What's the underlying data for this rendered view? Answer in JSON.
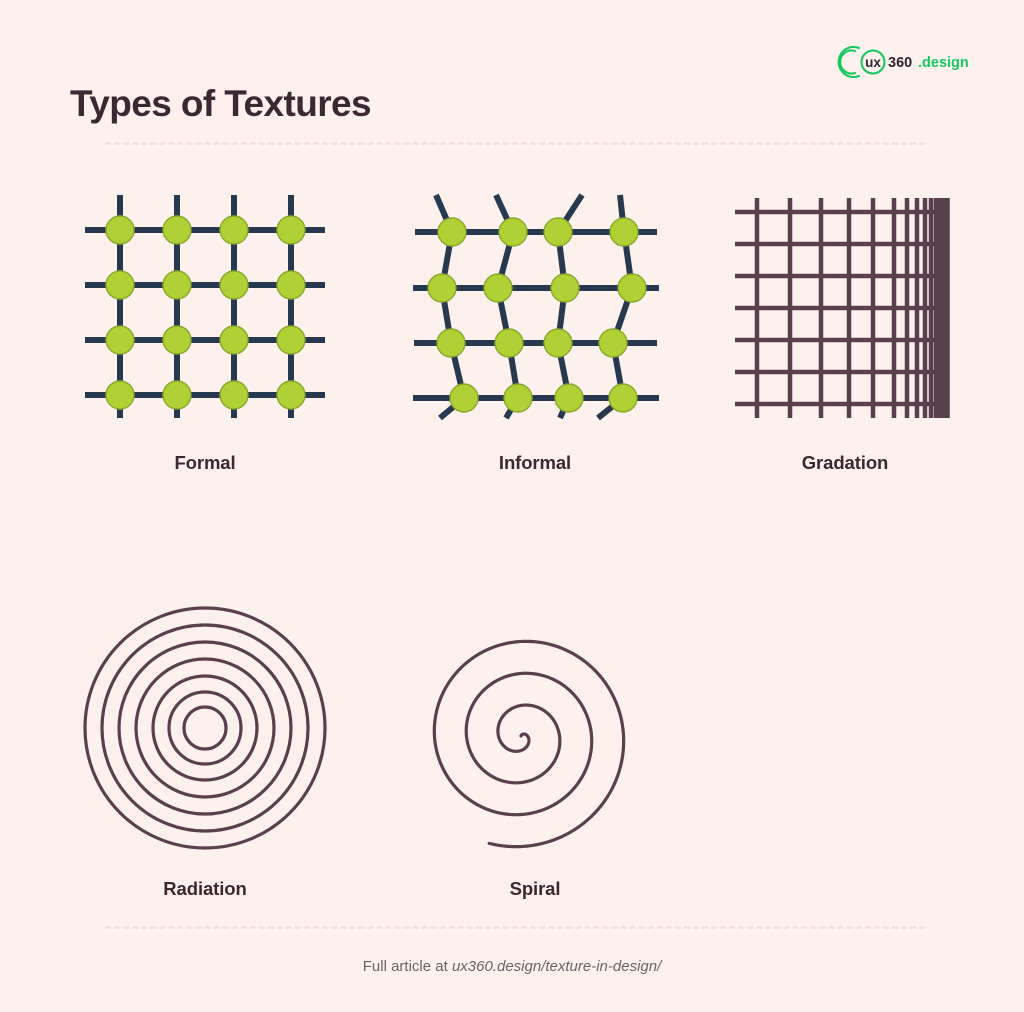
{
  "header": {
    "title": "Types of Textures",
    "logo": {
      "mark_name": "ux360-logo",
      "text_ux": "ux",
      "text_360": "360",
      "text_domain": ".design",
      "green": "#16c95f",
      "dark": "#2f2430"
    }
  },
  "theme": {
    "background": "#fdf1ee",
    "title_color": "#3b2833",
    "label_color": "#3b2833",
    "node_green": "#b0d136",
    "node_stroke": "#8aa62b",
    "line_navy": "#26394f",
    "line_plum": "#5a3f4d",
    "divider_color": "#f4e2df",
    "footer_color": "#6f6169"
  },
  "figures": [
    {
      "id": "formal",
      "label": "Formal",
      "type": "regular-grid",
      "rows": 4,
      "cols": 4,
      "node_count": 16,
      "line_color": "#26394f",
      "node_color": "#b0d136"
    },
    {
      "id": "informal",
      "label": "Informal",
      "type": "irregular-grid",
      "rows": 4,
      "cols": 4,
      "node_count": 16,
      "line_color": "#26394f",
      "node_color": "#b0d136"
    },
    {
      "id": "gradation",
      "label": "Gradation",
      "type": "gradient-grid",
      "horizontal_lines": 7,
      "vertical_lines": 15,
      "line_color": "#5a3f4d"
    },
    {
      "id": "radiation",
      "label": "Radiation",
      "type": "concentric-circles",
      "ring_count": 7,
      "line_color": "#5a3f4d"
    },
    {
      "id": "spiral",
      "label": "Spiral",
      "type": "archimedean-spiral",
      "turns": 3.5,
      "line_color": "#5a3f4d"
    }
  ],
  "footer": {
    "prefix": "Full article at ",
    "url": "ux360.design/texture-in-design/"
  }
}
